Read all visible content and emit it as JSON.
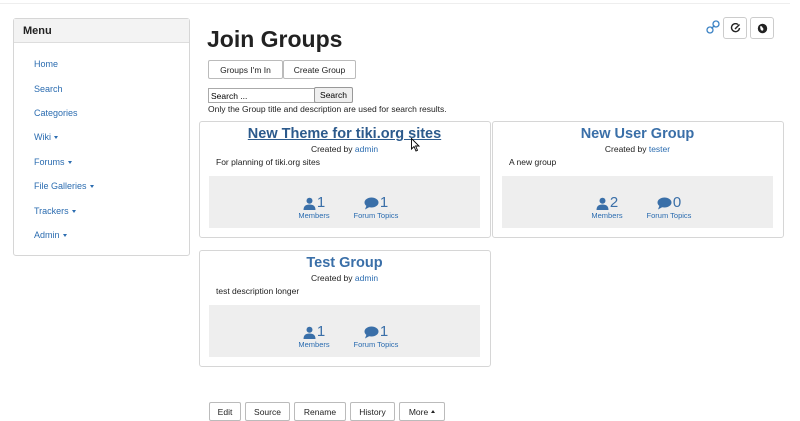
{
  "menu": {
    "title": "Menu",
    "items": [
      {
        "label": "Home"
      },
      {
        "label": "Search"
      },
      {
        "label": "Categories"
      },
      {
        "label": "Wiki"
      },
      {
        "label": "Forums"
      },
      {
        "label": "File Galleries"
      },
      {
        "label": "Trackers"
      },
      {
        "label": "Admin"
      }
    ]
  },
  "header": {
    "icons": [
      "link-icon",
      "edit-icon",
      "globe-icon"
    ]
  },
  "page": {
    "title": "Join Groups",
    "tabs": [
      {
        "label": "Groups I'm In"
      },
      {
        "label": "Create Group"
      }
    ],
    "search": {
      "value": "Search ...",
      "button": "Search",
      "hint": "Only the Group title and description are used for search results."
    }
  },
  "groups": [
    {
      "title": "New Theme for tiki.org sites",
      "created_by_prefix": "Created by",
      "created_by": "admin",
      "description": "For planning of tiki.org sites",
      "members": "1",
      "members_label": "Members",
      "topics": "1",
      "topics_label": "Forum Topics"
    },
    {
      "title": "New User Group",
      "created_by_prefix": "Created by",
      "created_by": "tester",
      "description": "A new group",
      "members": "2",
      "members_label": "Members",
      "topics": "0",
      "topics_label": "Forum Topics"
    },
    {
      "title": "Test Group",
      "created_by_prefix": "Created by",
      "created_by": "admin",
      "description": "test description longer",
      "members": "1",
      "members_label": "Members",
      "topics": "1",
      "topics_label": "Forum Topics"
    }
  ],
  "actions": [
    {
      "label": "Edit"
    },
    {
      "label": "Source"
    },
    {
      "label": "Rename"
    },
    {
      "label": "History"
    },
    {
      "label": "More"
    }
  ],
  "colors": {
    "accent": "#3a6fa8",
    "link": "#2b6cb0",
    "stats_bg": "#eeeeee"
  }
}
